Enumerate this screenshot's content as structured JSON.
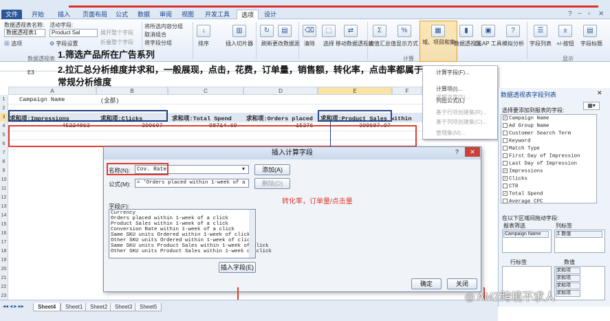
{
  "ribbon_tabs": [
    "文件",
    "开始",
    "插入",
    "页面布局",
    "公式",
    "数据",
    "审阅",
    "视图",
    "开发工具",
    "选项",
    "设计"
  ],
  "ribbon": {
    "pivot_name_label": "数据透视表名称:",
    "pivot_name": "数据透视表1",
    "options": "选项",
    "active_field_label": "活动字段:",
    "active_field": "Product Sal",
    "field_settings": "字段设置",
    "expand": "展开整个字段",
    "collapse": "折叠整个字段",
    "group_sel": "将所选内容分组",
    "ungroup": "取消组合",
    "group_field": "将字段分组",
    "sort": "排序",
    "insert_slicer": "插入切片器",
    "refresh": "刷新",
    "change_source": "更改数据源",
    "clear": "清除",
    "select": "选择",
    "move_pivot": "移动数据透视表",
    "calc_summary": "按值汇总",
    "show_values": "值显示方式",
    "fields_items": "域、项目和集",
    "pivot_chart": "数据透视图",
    "olap": "OLAP 工具",
    "what_if": "模拟分析",
    "field_list": "字段列表",
    "plus_minus": "+/-按钮",
    "field_headers": "字段标题",
    "grp_pivot": "数据透视表",
    "grp_calc": "计算",
    "grp_show": "显示"
  },
  "name_box": "E3",
  "columns": [
    "A",
    "B",
    "C",
    "D",
    "E",
    "F"
  ],
  "rows": [
    "1",
    "2",
    "3",
    "4",
    "5",
    "6",
    "7",
    "8",
    "9",
    "10",
    "11",
    "12",
    "13",
    "14",
    "15",
    "16",
    "17",
    "18",
    "19",
    "20",
    "21",
    "22",
    "23",
    "24"
  ],
  "cells": {
    "a1": "Campaign Name",
    "b1": "(全部)",
    "h1": "求和项:Impressions",
    "h2": "求和项:Clicks",
    "h3": "求和项:Total Spend",
    "h4": "求和项:Orders placed",
    "h5": "求和项:Product Sales within",
    "v1": "45224063",
    "v2": "399607",
    "v3": "98714.69",
    "v4": "15376",
    "v5": "399607.97"
  },
  "instructions": [
    "1.筛选产品所在广告系列",
    "2.拉汇总分析维度并求和，一般展现，点击，花费，订单量，销售额，转化率，点击率都属于",
    "常规分析维度"
  ],
  "context_menu": [
    "计算字段(F)...",
    "计算项(I)...",
    "求解次序(S)...",
    "列出公式(L)",
    "基于行项创建集(R)...",
    "基于列项创建集(C)...",
    "管理集(M)..."
  ],
  "field_panel": {
    "title": "数据透视表字段列表",
    "subtitle": "选择要添加到报表的字段:",
    "fields": [
      {
        "name": "Campaign Name",
        "checked": true
      },
      {
        "name": "Ad Group Name",
        "checked": false
      },
      {
        "name": "Customer Search Term",
        "checked": false
      },
      {
        "name": "Keyword",
        "checked": false
      },
      {
        "name": "Match Type",
        "checked": false
      },
      {
        "name": "First Day of Impression",
        "checked": false
      },
      {
        "name": "Last Day of Impression",
        "checked": false
      },
      {
        "name": "Impressions",
        "checked": true
      },
      {
        "name": "Clicks",
        "checked": true
      },
      {
        "name": "CTR",
        "checked": false
      },
      {
        "name": "Total Spend",
        "checked": true
      },
      {
        "name": "Average CPC",
        "checked": false
      }
    ],
    "drag_label": "在以下区域间拖动字段:",
    "report_filter": "报表筛选",
    "column_labels": "列标签",
    "row_labels": "行标签",
    "values": "数值",
    "filter_item": "Campaign Name",
    "col_item": "Σ 数值",
    "val_items": [
      "求和项",
      "求和项",
      "求和项",
      "求和项"
    ]
  },
  "dialog": {
    "title": "插入计算字段",
    "name_label": "名称(N):",
    "name_value": "Cov. Rate",
    "formula_label": "公式(M):",
    "formula_value": "= 'Orders placed within 1-week of a click'/",
    "add_button": "添加(A)",
    "delete_button": "删除(D)",
    "fields_label": "字段(F):",
    "fields": [
      "Currency",
      "Orders placed within 1-week of a click",
      "Product Sales within 1-week of a click",
      "Conversion Rate within 1-week of a click",
      "Same SKU units Ordered within 1-week of click",
      "Other SKU units Ordered within 1-week of click",
      "Same SKU units Product Sales within 1-week of click",
      "Other SKU units Product Sales within 1-week of click"
    ],
    "insert_field_button": "插入字段(E)",
    "ok_button": "确定",
    "close_button": "关闭",
    "annotation": "转化率，订单量/点击量"
  },
  "sheet_tabs": [
    "Sheet4",
    "Sheet1",
    "Sheet2",
    "Sheet3",
    "Sheet5"
  ],
  "watermark": "AMZ跨境不求人",
  "colors": {
    "annotation_red": "#e03a2e",
    "ribbon_blue": "#2b579a"
  }
}
